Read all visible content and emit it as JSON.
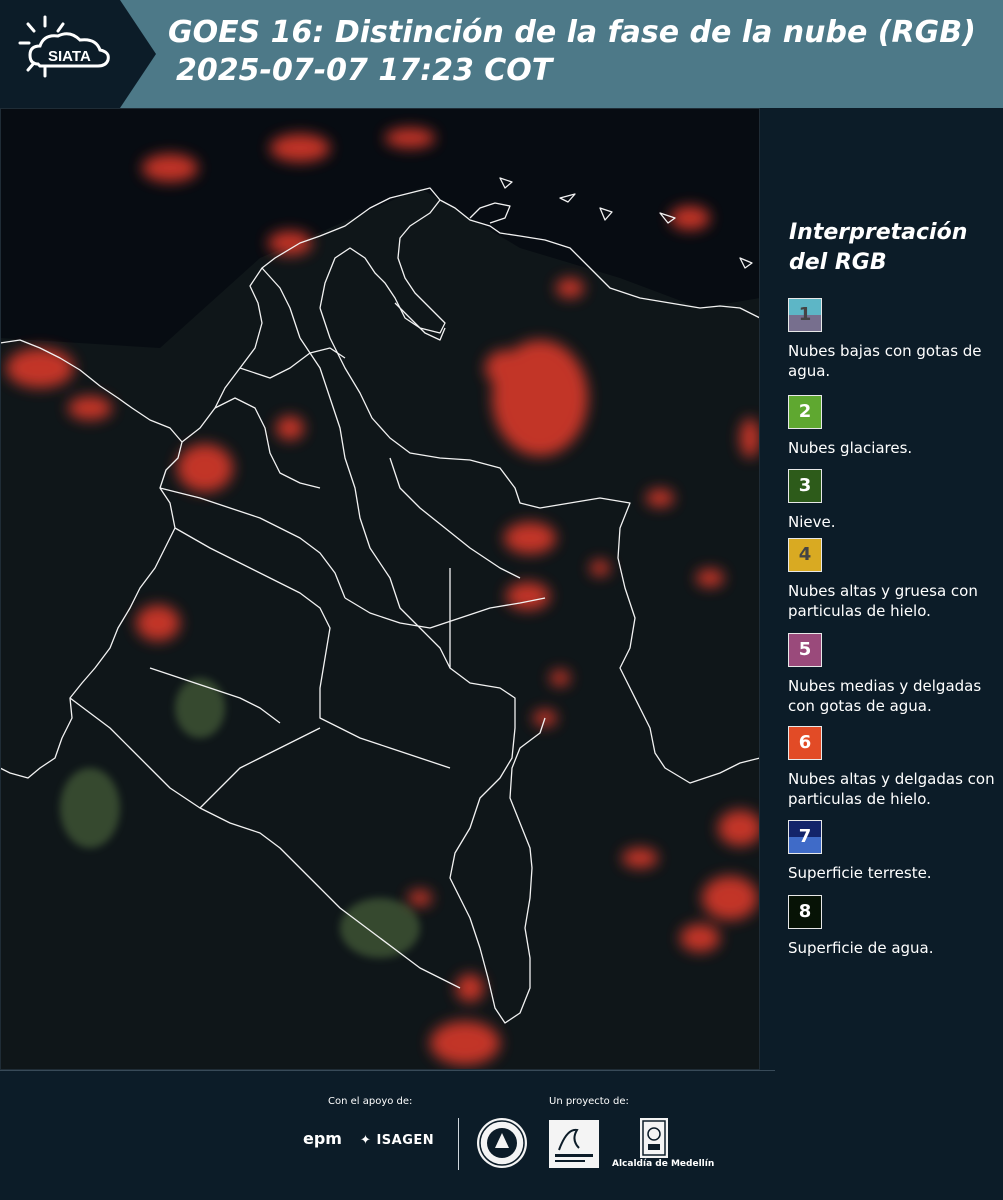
{
  "header": {
    "logo_text": "SIATA",
    "title_line1": "GOES 16: Distinción de la fase de la nube (RGB)",
    "title_line2": "2025-07-07 17:23 COT"
  },
  "legend": {
    "title_line1": "Interpretación",
    "title_line2": "del RGB",
    "items": [
      {
        "num": "1",
        "label": "Nubes bajas con gotas de agua.",
        "color_top": "#5db6c6",
        "color_bottom": "#776f8e",
        "num_color": "#444444"
      },
      {
        "num": "2",
        "label": "Nubes glaciares.",
        "color_top": "#5fa830",
        "color_bottom": "#5fa830",
        "num_color": "#ffffff"
      },
      {
        "num": "3",
        "label": "Nieve.",
        "color_top": "#2d5b1a",
        "color_bottom": "#2d5b1a",
        "num_color": "#ffffff"
      },
      {
        "num": "4",
        "label": "Nubes altas y gruesa con particulas de hielo.",
        "color_top": "#d9aa22",
        "color_bottom": "#d9aa22",
        "num_color": "#444444"
      },
      {
        "num": "5",
        "label": "Nubes medias y delgadas con gotas de agua.",
        "color_top": "#9a4a7b",
        "color_bottom": "#9a4a7b",
        "num_color": "#ffffff"
      },
      {
        "num": "6",
        "label": "Nubes altas y delgadas con particulas de hielo.",
        "color_top": "#e24b26",
        "color_bottom": "#e24b26",
        "num_color": "#ffffff"
      },
      {
        "num": "7",
        "label": "Superficie terreste.",
        "color_top": "#13246a",
        "color_bottom": "#3f6bc8",
        "num_color": "#ffffff"
      },
      {
        "num": "8",
        "label": "Superficie de agua.",
        "color_top": "#071306",
        "color_bottom": "#071306",
        "num_color": "#ffffff"
      }
    ]
  },
  "footer": {
    "support_label": "Con el apoyo de:",
    "project_label": "Un proyecto de:",
    "epm_text": "epm",
    "isagen_text": "ISAGEN",
    "alcaldia_text": "Alcaldía de Medellín"
  }
}
